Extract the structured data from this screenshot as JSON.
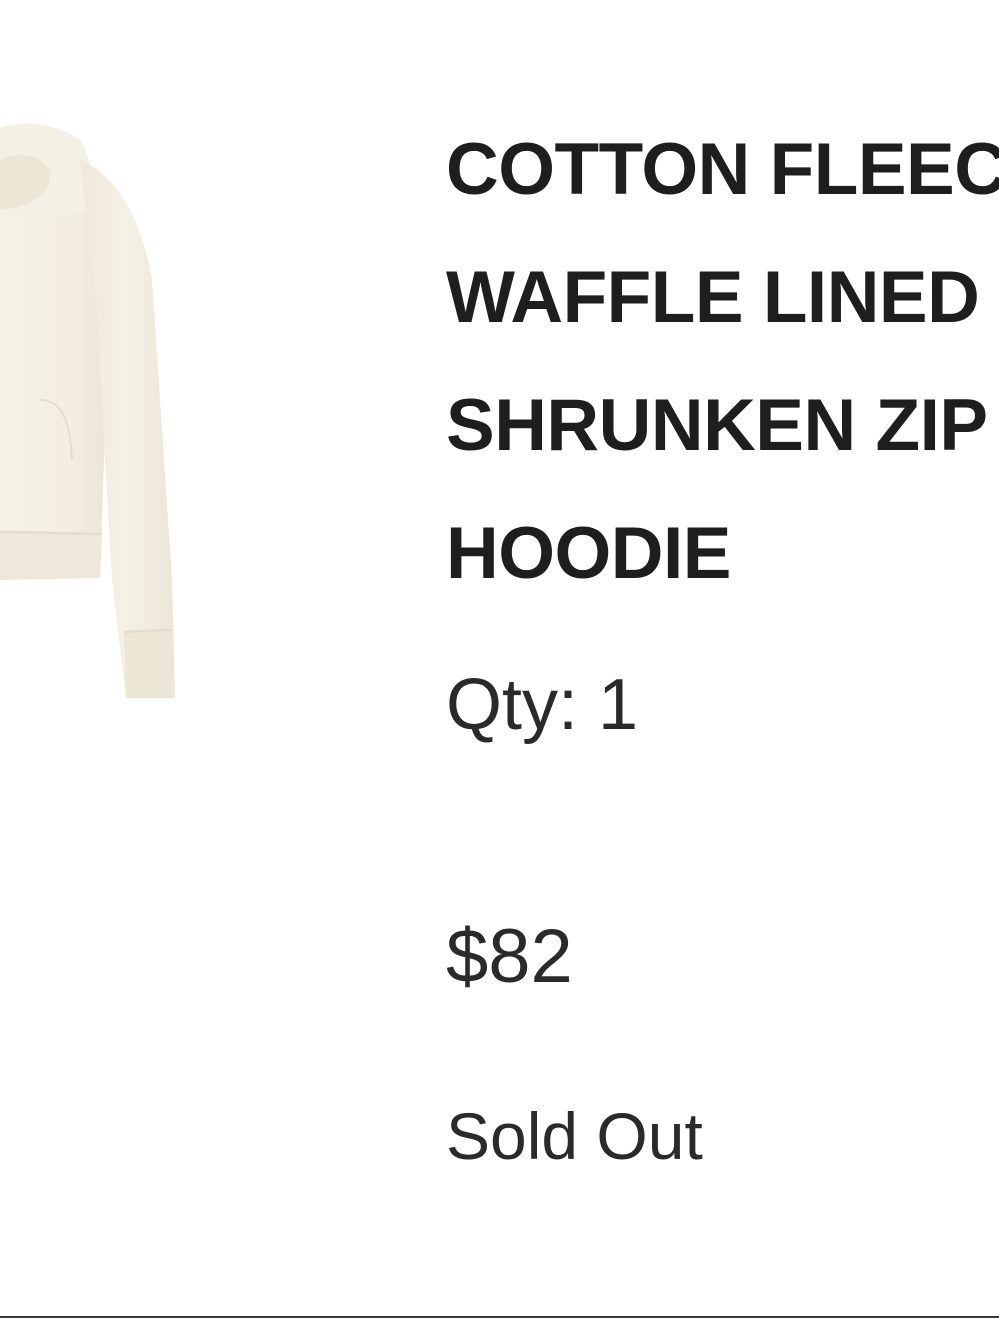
{
  "product": {
    "image_icon": "hoodie-image",
    "title_lines": [
      "COTTON FLEECE",
      "WAFFLE LINED",
      "SHRUNKEN ZIP",
      "HOODIE"
    ],
    "quantity_label": "Qty: 1",
    "price": "$82",
    "status": "Sold Out"
  },
  "colors": {
    "garment": "#f3eee1",
    "text": "#1e1e1e",
    "divider": "#3a3a3a"
  }
}
